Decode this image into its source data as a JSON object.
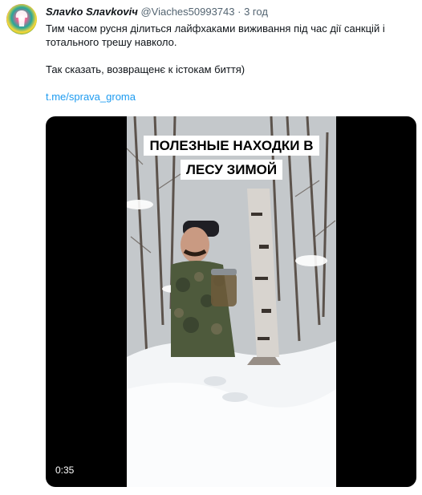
{
  "tweet": {
    "author_name": "Sлavko Sлavkoviч",
    "handle": "@Viaches50993743",
    "separator": "·",
    "time": "3 год",
    "text_line1": "Тим часом русня ділиться лайфхаками виживання під час дії санкцій і",
    "text_line2": "тотального трешу навколо.",
    "text_line3": "Так сказать, возвращенє к істокам биття)",
    "link": "t.me/sprava_groma"
  },
  "video": {
    "caption_line1": "ПОЛЕЗНЫЕ НАХОДКИ В",
    "caption_line2": "ЛЕСУ ЗИМОЙ",
    "duration": "0:35"
  },
  "colors": {
    "text": "#0f1419",
    "muted": "#536471",
    "link": "#1d9bf0",
    "media_bg": "#000000"
  }
}
